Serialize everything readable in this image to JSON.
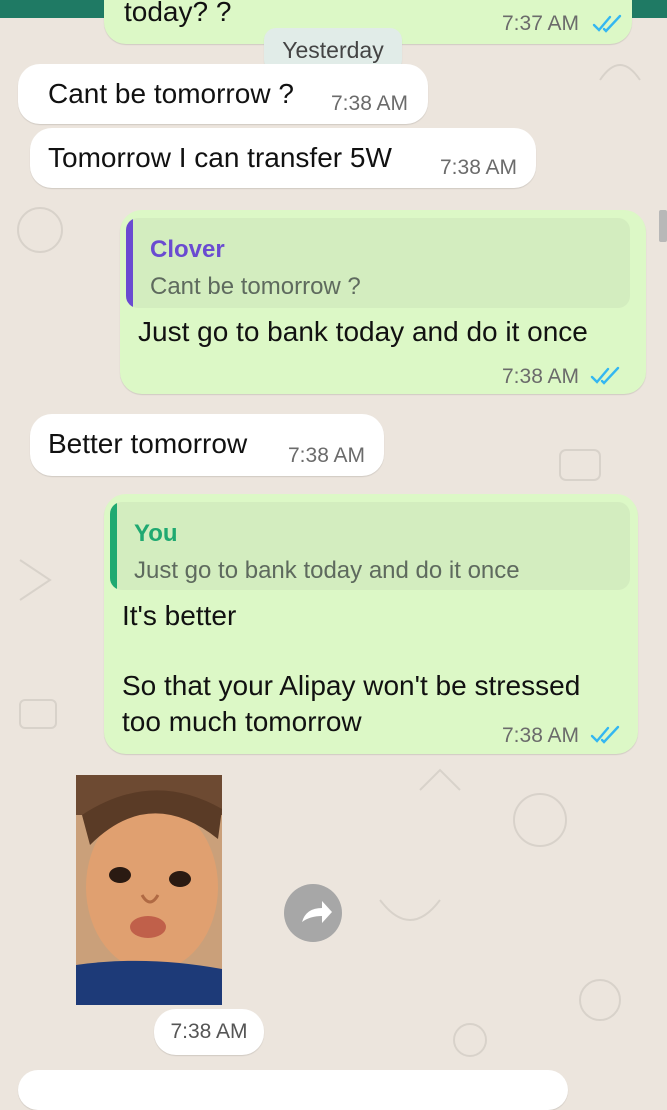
{
  "header": {
    "bar_color": "#1f7a64"
  },
  "colors": {
    "incoming": "#ffffff",
    "outgoing": "#dcf8c6",
    "read_ticks": "#34b7f1",
    "quote_name_other": "#6a4bd1",
    "quote_name_you": "#1fa971"
  },
  "messages": {
    "partial_top": {
      "text": "today? ?",
      "time": "7:37 AM"
    },
    "date_divider": "Yesterday",
    "m1": {
      "text": "Cant be tomorrow ?",
      "time": "7:38 AM"
    },
    "m2": {
      "text": "Tomorrow I can transfer 5W",
      "time": "7:38 AM"
    },
    "m3": {
      "quote_name": "Clover",
      "quote_text": "Cant be tomorrow ?",
      "text": "Just go to bank today and do it once",
      "time": "7:38 AM"
    },
    "m4": {
      "text": "Better tomorrow",
      "time": "7:38 AM"
    },
    "m5": {
      "quote_name": "You",
      "quote_text": "Just go to bank today and do it once",
      "line1": "It's better",
      "line2": "So that your Alipay won't be stressed",
      "line3": "too much tomorrow",
      "time": "7:38 AM"
    },
    "m6": {
      "icon": "forward-icon",
      "time": "7:38 AM"
    }
  }
}
